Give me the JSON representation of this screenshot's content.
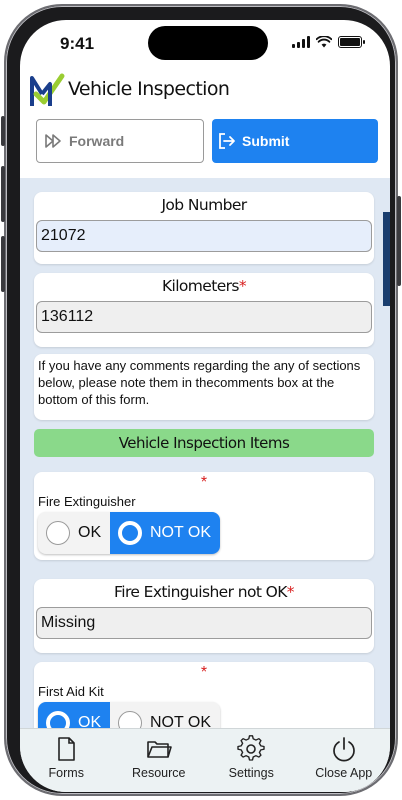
{
  "status_bar": {
    "time": "9:41"
  },
  "header": {
    "title": "Vehicle Inspection"
  },
  "actions": {
    "forward_label": "Forward",
    "submit_label": "Submit"
  },
  "form": {
    "job_number": {
      "label": "Job Number",
      "value": "21072"
    },
    "kilometers": {
      "label": "Kilometers",
      "required_mark": "*",
      "value": "136112"
    },
    "comments_note": "If you have any comments regarding the any of sections below, please note them in thecomments box at the bottom of this form.",
    "section_title": "Vehicle Inspection Items",
    "fire_extinguisher": {
      "required_mark": "*",
      "label": "Fire Extinguisher",
      "options": [
        "OK",
        "NOT OK"
      ],
      "selected": "NOT OK"
    },
    "fire_extinguisher_not_ok": {
      "label": "Fire Extinguisher not OK",
      "required_mark": "*",
      "value": "Missing"
    },
    "first_aid_kit": {
      "required_mark": "*",
      "label": "First Aid Kit",
      "options": [
        "OK",
        "NOT OK"
      ],
      "selected": "OK"
    }
  },
  "tabbar": {
    "items": [
      {
        "label": "Forms",
        "icon": "document-icon"
      },
      {
        "label": "Resource",
        "icon": "folder-icon"
      },
      {
        "label": "Settings",
        "icon": "gear-icon"
      },
      {
        "label": "Close App",
        "icon": "power-icon"
      }
    ]
  },
  "colors": {
    "accent": "#1e82f0",
    "section_bar": "#8ad98a",
    "required": "#d82020",
    "content_bg": "#dfe8f3",
    "logo_blue": "#1a3e8c",
    "logo_green": "#9acd32"
  }
}
